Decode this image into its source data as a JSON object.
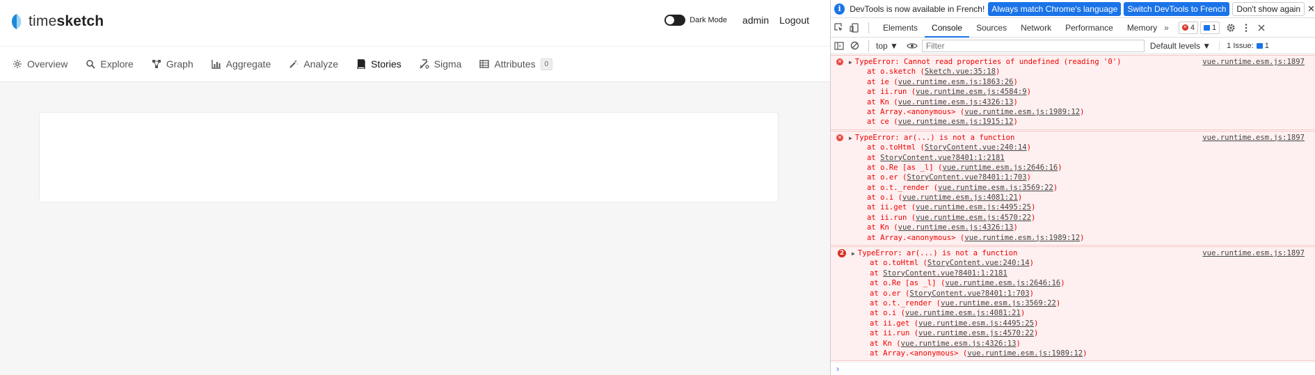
{
  "app": {
    "logo_prefix": "time",
    "logo_bold": "sketch",
    "dark_mode_label": "Dark Mode",
    "user": "admin",
    "logout": "Logout",
    "nav": [
      {
        "label": "Overview",
        "icon": "overview-icon"
      },
      {
        "label": "Explore",
        "icon": "search-icon"
      },
      {
        "label": "Graph",
        "icon": "graph-icon"
      },
      {
        "label": "Aggregate",
        "icon": "bar-chart-icon"
      },
      {
        "label": "Analyze",
        "icon": "magic-wand-icon"
      },
      {
        "label": "Stories",
        "icon": "book-icon",
        "active": true
      },
      {
        "label": "Sigma",
        "icon": "sigma-icon"
      },
      {
        "label": "Attributes",
        "icon": "table-icon",
        "badge": "0"
      }
    ]
  },
  "devtools": {
    "infobar": {
      "text": "DevTools is now available in French!",
      "btn_match": "Always match Chrome's language",
      "btn_switch": "Switch DevTools to French",
      "btn_dismiss": "Don't show again",
      "close": "✕"
    },
    "tabs": [
      "Elements",
      "Console",
      "Sources",
      "Network",
      "Performance",
      "Memory"
    ],
    "active_tab": "Console",
    "tab_more": "»",
    "error_count": "4",
    "message_count": "1",
    "context": "top ▼",
    "filter_placeholder": "Filter",
    "levels": "Default levels ▼",
    "issues_label": "1 Issue:",
    "issues_count": "1",
    "messages": [
      {
        "text": "TypeError: Cannot read properties of undefined (reading '0')",
        "source": "vue.runtime.esm.js:1897",
        "frames": [
          {
            "fn": "at o.sketch (",
            "loc": "Sketch.vue:35:18",
            "end": ")"
          },
          {
            "fn": "at ie (",
            "loc": "vue.runtime.esm.js:1863:26",
            "end": ")"
          },
          {
            "fn": "at ii.run (",
            "loc": "vue.runtime.esm.js:4584:9",
            "end": ")"
          },
          {
            "fn": "at Kn (",
            "loc": "vue.runtime.esm.js:4326:13",
            "end": ")"
          },
          {
            "fn": "at Array.<anonymous> (",
            "loc": "vue.runtime.esm.js:1989:12",
            "end": ")"
          },
          {
            "fn": "at ce (",
            "loc": "vue.runtime.esm.js:1915:12",
            "end": ")"
          }
        ]
      },
      {
        "text": "TypeError: ar(...) is not a function",
        "source": "vue.runtime.esm.js:1897",
        "frames": [
          {
            "fn": "at o.toHtml (",
            "loc": "StoryContent.vue:240:14",
            "end": ")"
          },
          {
            "fn": "at ",
            "loc": "StoryContent.vue?8401:1:2181",
            "end": ""
          },
          {
            "fn": "at o.Re [as _l] (",
            "loc": "vue.runtime.esm.js:2646:16",
            "end": ")"
          },
          {
            "fn": "at o.er (",
            "loc": "StoryContent.vue?8401:1:703",
            "end": ")"
          },
          {
            "fn": "at o.t._render (",
            "loc": "vue.runtime.esm.js:3569:22",
            "end": ")"
          },
          {
            "fn": "at o.i (",
            "loc": "vue.runtime.esm.js:4081:21",
            "end": ")"
          },
          {
            "fn": "at ii.get (",
            "loc": "vue.runtime.esm.js:4495:25",
            "end": ")"
          },
          {
            "fn": "at ii.run (",
            "loc": "vue.runtime.esm.js:4570:22",
            "end": ")"
          },
          {
            "fn": "at Kn (",
            "loc": "vue.runtime.esm.js:4326:13",
            "end": ")"
          },
          {
            "fn": "at Array.<anonymous> (",
            "loc": "vue.runtime.esm.js:1989:12",
            "end": ")"
          }
        ]
      },
      {
        "count": "2",
        "text": "TypeError: ar(...) is not a function",
        "source": "vue.runtime.esm.js:1897",
        "frames": [
          {
            "fn": "at o.toHtml (",
            "loc": "StoryContent.vue:240:14",
            "end": ")"
          },
          {
            "fn": "at ",
            "loc": "StoryContent.vue?8401:1:2181",
            "end": ""
          },
          {
            "fn": "at o.Re [as _l] (",
            "loc": "vue.runtime.esm.js:2646:16",
            "end": ")"
          },
          {
            "fn": "at o.er (",
            "loc": "StoryContent.vue?8401:1:703",
            "end": ")"
          },
          {
            "fn": "at o.t._render (",
            "loc": "vue.runtime.esm.js:3569:22",
            "end": ")"
          },
          {
            "fn": "at o.i (",
            "loc": "vue.runtime.esm.js:4081:21",
            "end": ")"
          },
          {
            "fn": "at ii.get (",
            "loc": "vue.runtime.esm.js:4495:25",
            "end": ")"
          },
          {
            "fn": "at ii.run (",
            "loc": "vue.runtime.esm.js:4570:22",
            "end": ")"
          },
          {
            "fn": "at Kn (",
            "loc": "vue.runtime.esm.js:4326:13",
            "end": ")"
          },
          {
            "fn": "at Array.<anonymous> (",
            "loc": "vue.runtime.esm.js:1989:12",
            "end": ")"
          }
        ]
      }
    ],
    "prompt": "›"
  }
}
